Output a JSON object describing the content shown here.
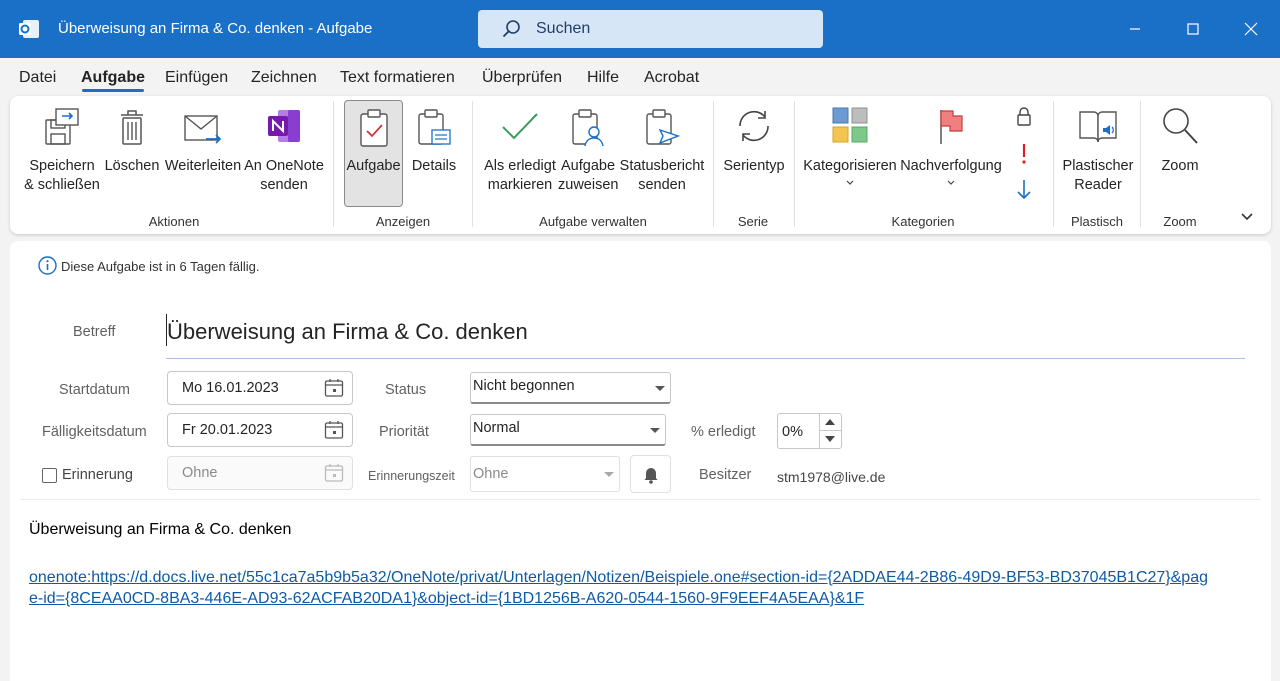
{
  "window": {
    "title": "Überweisung an Firma & Co. denken  -  Aufgabe",
    "search_label": "Suchen"
  },
  "menu": [
    "Datei",
    "Aufgabe",
    "Einfügen",
    "Zeichnen",
    "Text formatieren",
    "Überprüfen",
    "Hilfe",
    "Acrobat"
  ],
  "menu_active": "Aufgabe",
  "ribbon": {
    "save": "Speichern\n& schließen",
    "delete": "Löschen",
    "forward": "Weiterleiten",
    "onenote": "An OneNote\nsenden",
    "task": "Aufgabe",
    "details": "Details",
    "mark_done": "Als erledigt\nmarkieren",
    "assign": "Aufgabe\nzuweisen",
    "status_report": "Statusbericht\nsenden",
    "recurrence": "Serientyp",
    "categorize": "Kategorisieren",
    "followup": "Nachverfolgung",
    "reader": "Plastischer\nReader",
    "zoom": "Zoom",
    "groups": {
      "actions": "Aktionen",
      "show": "Anzeigen",
      "manage": "Aufgabe verwalten",
      "series": "Serie",
      "categories": "Kategorien",
      "immersive": "Plastisch",
      "zoom": "Zoom"
    }
  },
  "form": {
    "info": "Diese Aufgabe ist in 6 Tagen fällig.",
    "subject_label": "Betreff",
    "subject": "Überweisung an Firma & Co. denken",
    "start_label": "Startdatum",
    "start": "Mo 16.01.2023",
    "due_label": "Fälligkeitsdatum",
    "due": "Fr 20.01.2023",
    "reminder_label": "Erinnerung",
    "reminder_date": "Ohne",
    "status_label": "Status",
    "status": "Nicht begonnen",
    "priority_label": "Priorität",
    "priority": "Normal",
    "reminder_time_label": "Erinnerungszeit",
    "reminder_time": "Ohne",
    "percent_label": "% erledigt",
    "percent": "0%",
    "owner_label": "Besitzer",
    "owner": "stm1978@live.de"
  },
  "body": {
    "text": "Überweisung an Firma & Co. denken",
    "link": "onenote:https://d.docs.live.net/55c1ca7a5b9b5a32/OneNote/privat/Unterlagen/Notizen/Beispiele.one#section-id={2ADDAE44-2B86-49D9-BF53-BD37045B1C27}&page-id={8CEAA0CD-8BA3-446E-AD93-62ACFAB20DA1}&object-id={1BD1256B-A620-0544-1560-9F9EEF4A5EAA}&1F"
  },
  "colors": {
    "titlebar": "#1a6fc7",
    "link": "#0f5aa6"
  }
}
